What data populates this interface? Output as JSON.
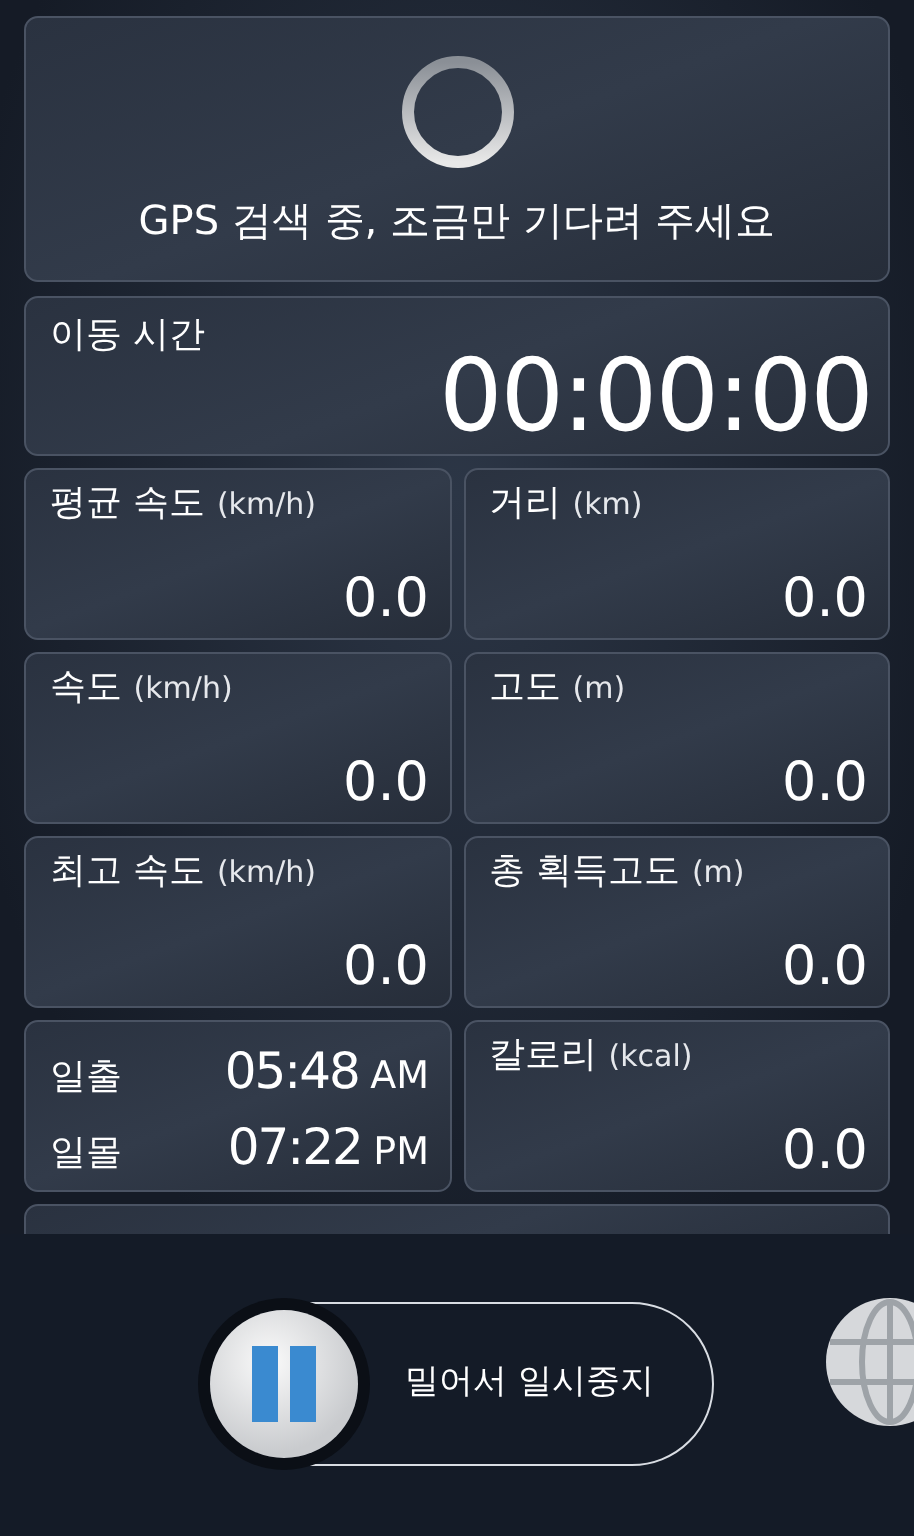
{
  "status": {
    "message": "GPS 검색 중, 조금만 기다려 주세요"
  },
  "elapsed": {
    "label": "이동 시간",
    "value": "00:00:00"
  },
  "tiles": [
    {
      "kind": "metric",
      "label": "평균 속도",
      "unit": "(km/h)",
      "value": "0.0"
    },
    {
      "kind": "metric",
      "label": "거리",
      "unit": "(km)",
      "value": "0.0"
    },
    {
      "kind": "metric",
      "label": "속도",
      "unit": "(km/h)",
      "value": "0.0"
    },
    {
      "kind": "metric",
      "label": "고도",
      "unit": "(m)",
      "value": "0.0"
    },
    {
      "kind": "metric",
      "label": "최고 속도",
      "unit": "(km/h)",
      "value": "0.0"
    },
    {
      "kind": "metric",
      "label": "총 획득고도",
      "unit": "(m)",
      "value": "0.0"
    },
    {
      "kind": "sun",
      "rows": [
        {
          "label": "일출",
          "time": "05:48",
          "period": "AM"
        },
        {
          "label": "일몰",
          "time": "07:22",
          "period": "PM"
        }
      ]
    },
    {
      "kind": "metric",
      "label": "칼로리",
      "unit": "(kcal)",
      "value": "0.0"
    }
  ],
  "pause_slider": {
    "label": "밀어서 일시중지",
    "level": 0
  }
}
